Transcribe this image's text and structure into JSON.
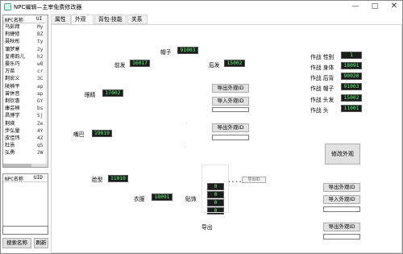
{
  "window": {
    "title": "NPC编辑—主宰免费修改器",
    "minimize_icon": "minimize-icon",
    "maximize_icon": "maximize-icon",
    "close_icon": "close-icon"
  },
  "npc_list": {
    "headers": [
      "NPC名称",
      "UI"
    ],
    "rows": [
      {
        "name": "乌彭拜",
        "code": "My"
      },
      {
        "name": "刑捷修",
        "code": "BZ"
      },
      {
        "name": "聂秋彤",
        "code": "ty"
      },
      {
        "name": "蒲梦寒",
        "code": "2y"
      },
      {
        "name": "皇甫韵儿",
        "code": "h2"
      },
      {
        "name": "晏乐巧",
        "code": "w8"
      },
      {
        "name": "万苗",
        "code": "cr"
      },
      {
        "name": "荆宏义",
        "code": "3C"
      },
      {
        "name": "陵楠平",
        "code": "ap"
      },
      {
        "name": "曾休音",
        "code": "ap"
      },
      {
        "name": "荆钦惠",
        "code": "GY"
      },
      {
        "name": "康芸楠",
        "code": "bs"
      },
      {
        "name": "昌博学",
        "code": "Sj"
      },
      {
        "name": "荆瑛",
        "code": "Ze"
      },
      {
        "name": "步弘量",
        "code": "4Y"
      },
      {
        "name": "皮佳玮",
        "code": "4Z"
      },
      {
        "name": "杜熹",
        "code": "q5"
      },
      {
        "name": "弘勇",
        "code": "2W"
      }
    ]
  },
  "second_list": {
    "headers": [
      "NPC名称",
      "UID"
    ]
  },
  "search_input": {
    "value": ""
  },
  "buttons": {
    "search_name": "搜索名称",
    "refresh": "刷新",
    "export_appearance_1": "导出外观ID",
    "import_appearance_1": "导入外观ID",
    "export_appearance_2": "导出外观ID",
    "export_appearance_3": "导出外观ID",
    "import_appearance_3": "导入外观ID",
    "export_appearance_4": "导出外观ID",
    "modify_appearance": "修改外观"
  },
  "tabs": [
    "属性",
    "外观",
    "背包-技能",
    "关系"
  ],
  "active_tab": "外观",
  "appearance": {
    "hat": {
      "label": "帽子",
      "value": "91003"
    },
    "front_hair": {
      "label": "前发",
      "value": "16017"
    },
    "back_hair": {
      "label": "后发",
      "value": "15002"
    },
    "eyes": {
      "label": "眼睛",
      "value": "17002"
    },
    "mouth": {
      "label": "嘴巴",
      "value": "19019"
    },
    "face_shape": {
      "label": "脸型",
      "value": "11010"
    },
    "clothes": {
      "label": "衣服",
      "value": "18091"
    },
    "accessory": {
      "label": "贴饰",
      "values": [
        "0",
        "0",
        "0",
        "0"
      ]
    },
    "guide_label": "导出ID",
    "export_label": "导出"
  },
  "battle_appearance": [
    {
      "label": "作战 性别",
      "value": "1"
    },
    {
      "label": "作战 身体",
      "value": "18091"
    },
    {
      "label": "作战 后背",
      "value": "90020"
    },
    {
      "label": "作战 帽子",
      "value": "91003"
    },
    {
      "label": "作战 头发",
      "value": "15002"
    },
    {
      "label": "作战  头",
      "value": "11001"
    }
  ]
}
